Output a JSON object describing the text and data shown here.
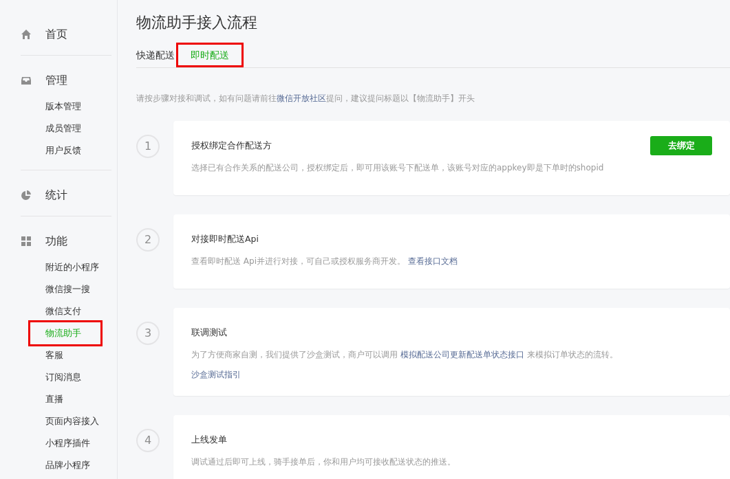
{
  "sidebar": {
    "groups": [
      {
        "kind": "home",
        "label": "首页"
      },
      {
        "kind": "inbox",
        "label": "管理",
        "items": [
          {
            "label": "版本管理",
            "selected": false,
            "highlighted": false
          },
          {
            "label": "成员管理",
            "selected": false,
            "highlighted": false
          },
          {
            "label": "用户反馈",
            "selected": false,
            "highlighted": false
          }
        ]
      },
      {
        "kind": "pie",
        "label": "统计"
      },
      {
        "kind": "grid",
        "label": "功能",
        "items": [
          {
            "label": "附近的小程序",
            "selected": false,
            "highlighted": false
          },
          {
            "label": "微信搜一搜",
            "selected": false,
            "highlighted": false
          },
          {
            "label": "微信支付",
            "selected": false,
            "highlighted": false
          },
          {
            "label": "物流助手",
            "selected": true,
            "highlighted": true
          },
          {
            "label": "客服",
            "selected": false,
            "highlighted": false
          },
          {
            "label": "订阅消息",
            "selected": false,
            "highlighted": false
          },
          {
            "label": "直播",
            "selected": false,
            "highlighted": false
          },
          {
            "label": "页面内容接入",
            "selected": false,
            "highlighted": false
          },
          {
            "label": "小程序插件",
            "selected": false,
            "highlighted": false
          },
          {
            "label": "品牌小程序",
            "selected": false,
            "highlighted": false
          }
        ]
      }
    ]
  },
  "page": {
    "title": "物流助手接入流程",
    "tabs": [
      {
        "label": "快递配送",
        "selected": false,
        "highlighted": false
      },
      {
        "label": "即时配送",
        "selected": true,
        "highlighted": true
      }
    ],
    "intro": [
      {
        "kind": "text",
        "text": "请按步骤对接和调试，如有问题请前往"
      },
      {
        "kind": "link",
        "text": "微信开放社区"
      },
      {
        "kind": "text",
        "text": "提问，建议提问标题以【物流助手】开头"
      }
    ],
    "steps": [
      {
        "number": "1",
        "title": "授权绑定合作配送方",
        "description": [
          {
            "kind": "text",
            "text": "选择已有合作关系的配送公司，授权绑定后，即可用该账号下配送单，该账号对应的appkey即是下单时的shopid"
          }
        ],
        "button": "去绑定"
      },
      {
        "number": "2",
        "title": "对接即时配送Api",
        "description": [
          {
            "kind": "text",
            "text": "查看即时配送 Api并进行对接，可自己或授权服务商开发。 "
          },
          {
            "kind": "link",
            "text": "查看接口文档"
          }
        ]
      },
      {
        "number": "3",
        "title": "联调测试",
        "description": [
          {
            "kind": "text",
            "text": "为了方便商家自测，我们提供了沙盒测试，商户可以调用 "
          },
          {
            "kind": "link",
            "text": "模拟配送公司更新配送单状态接口"
          },
          {
            "kind": "text",
            "text": " 来模拟订单状态的流转。"
          }
        ],
        "extra_link": "沙盒测试指引"
      },
      {
        "number": "4",
        "title": "上线发单",
        "description": [
          {
            "kind": "text",
            "text": "调试通过后即可上线，骑手接单后，你和用户均可接收配送状态的推送。"
          }
        ]
      }
    ]
  }
}
